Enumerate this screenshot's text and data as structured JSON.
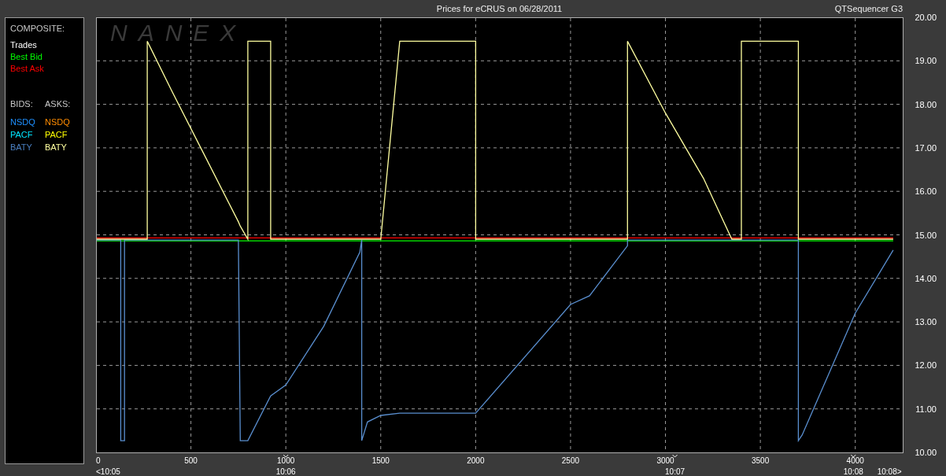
{
  "window": {
    "title": "Prices for  eCRUS  on  06/28/2011",
    "app_name": "QTSequencer G3"
  },
  "legend": {
    "composite_header": "COMPOSITE:",
    "composite": [
      {
        "label": "Trades",
        "color": "#ffffff"
      },
      {
        "label": "Best Bid",
        "color": "#00ff00"
      },
      {
        "label": "Best Ask",
        "color": "#ff0000"
      }
    ],
    "bids_header": "BIDS:",
    "asks_header": "ASKS:",
    "bids": [
      {
        "label": "NSDQ",
        "color": "#1e90ff"
      },
      {
        "label": "PACF",
        "color": "#00e5ff"
      },
      {
        "label": "BATY",
        "color": "#4a7fc0"
      }
    ],
    "asks": [
      {
        "label": "NSDQ",
        "color": "#ff8c00"
      },
      {
        "label": "PACF",
        "color": "#ffff00"
      },
      {
        "label": "BATY",
        "color": "#ffffa0"
      }
    ]
  },
  "chart": {
    "logo_text": "NANEX",
    "chart_data": {
      "type": "line",
      "xlim": [
        0,
        4250
      ],
      "ylim": [
        10,
        20
      ],
      "xticks": [
        0,
        500,
        1000,
        1500,
        2000,
        2500,
        3000,
        3500,
        4000
      ],
      "yticks": [
        {
          "value": 10,
          "label": "10.00"
        },
        {
          "value": 11,
          "label": "11.00"
        },
        {
          "value": 12,
          "label": "12.00"
        },
        {
          "value": 13,
          "label": "13.00"
        },
        {
          "value": 14,
          "label": "14.00"
        },
        {
          "value": 15,
          "label": "15.00"
        },
        {
          "value": 16,
          "label": "16.00"
        },
        {
          "value": 17,
          "label": "17.00"
        },
        {
          "value": 18,
          "label": "18.00"
        },
        {
          "value": 19,
          "label": "19.00"
        },
        {
          "value": 20,
          "label": "20.00"
        }
      ],
      "x": [
        0,
        130,
        130,
        150,
        150,
        270,
        270,
        400,
        750,
        760,
        800,
        800,
        920,
        920,
        1000,
        1200,
        1390,
        1400,
        1400,
        1430,
        1500,
        1600,
        2000,
        2000,
        2500,
        2600,
        2800,
        2800,
        3000,
        3200,
        3350,
        3400,
        3400,
        3460,
        3700,
        3700,
        3720,
        3720,
        4000,
        4200
      ],
      "series": [
        {
          "color": "#ff0000",
          "values": [
            14.93,
            14.93,
            14.93,
            14.93,
            14.93,
            14.93,
            14.93,
            14.93,
            14.93,
            14.93,
            14.93,
            14.93,
            14.93,
            14.93,
            14.93,
            14.93,
            14.93,
            14.93,
            14.93,
            14.93,
            14.93,
            14.93,
            14.93,
            14.93,
            14.93,
            14.93,
            14.93,
            14.93,
            14.93,
            14.93,
            14.93,
            14.93,
            14.93,
            14.93,
            14.93,
            14.93,
            14.93,
            14.93,
            14.93,
            14.93
          ]
        },
        {
          "color": "#00ff00",
          "values": [
            14.86,
            14.86,
            14.86,
            14.86,
            14.86,
            14.86,
            14.86,
            14.86,
            14.86,
            14.86,
            14.86,
            14.86,
            14.86,
            14.86,
            14.86,
            14.86,
            14.86,
            14.86,
            14.86,
            14.86,
            14.86,
            14.86,
            14.86,
            14.86,
            14.86,
            14.86,
            14.86,
            14.86,
            14.86,
            14.86,
            14.86,
            14.86,
            14.86,
            14.86,
            14.86,
            14.86,
            14.86,
            14.86,
            14.86,
            14.86
          ]
        },
        {
          "color": "#5a8fd0",
          "values": [
            14.88,
            14.88,
            10.27,
            10.27,
            14.88,
            14.88,
            14.88,
            14.88,
            14.88,
            10.27,
            10.27,
            10.27,
            11.3,
            11.3,
            11.55,
            12.9,
            14.6,
            14.88,
            10.27,
            10.7,
            10.85,
            10.9,
            10.9,
            10.9,
            13.4,
            13.6,
            14.75,
            14.88,
            14.88,
            14.88,
            14.88,
            14.88,
            14.88,
            14.88,
            14.88,
            10.27,
            10.4,
            10.4,
            13.2,
            14.65
          ]
        },
        {
          "color": "#ffffa0",
          "values": [
            14.9,
            14.9,
            14.9,
            14.9,
            14.9,
            14.9,
            19.45,
            18.3,
            15.3,
            15.2,
            14.9,
            19.45,
            19.45,
            14.9,
            14.9,
            14.9,
            14.9,
            14.9,
            14.9,
            14.9,
            14.9,
            19.45,
            19.45,
            14.9,
            14.9,
            14.9,
            14.9,
            19.45,
            17.8,
            16.3,
            14.9,
            14.9,
            19.45,
            19.45,
            19.45,
            14.9,
            14.9,
            14.9,
            14.9,
            14.9
          ]
        }
      ],
      "grid": true
    },
    "time_labels": [
      {
        "text": "<10:05",
        "marked": false
      },
      {
        "text": "10:06",
        "marked": true
      },
      {
        "text": "10:07",
        "marked": true
      },
      {
        "text": "10:08",
        "marked": true
      },
      {
        "text": "10:08>",
        "marked": false
      }
    ]
  }
}
